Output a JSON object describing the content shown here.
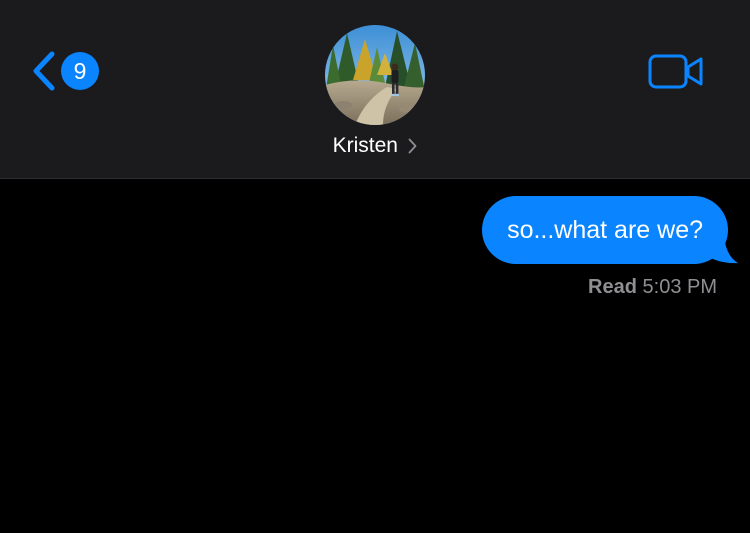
{
  "header": {
    "unread_count": "9",
    "contact_name": "Kristen",
    "avatar": "contact-photo-forest-trail",
    "video_icon": "video-camera-icon",
    "back_icon": "chevron-left-icon"
  },
  "conversation": {
    "messages": [
      {
        "direction": "outgoing",
        "text": "so...what are we?"
      }
    ],
    "receipt": {
      "status": "Read",
      "time": "5:03 PM"
    }
  },
  "colors": {
    "accent": "#0a84ff",
    "header_bg": "#1b1b1d",
    "background": "#000000",
    "secondary_text": "#8e8e93"
  }
}
